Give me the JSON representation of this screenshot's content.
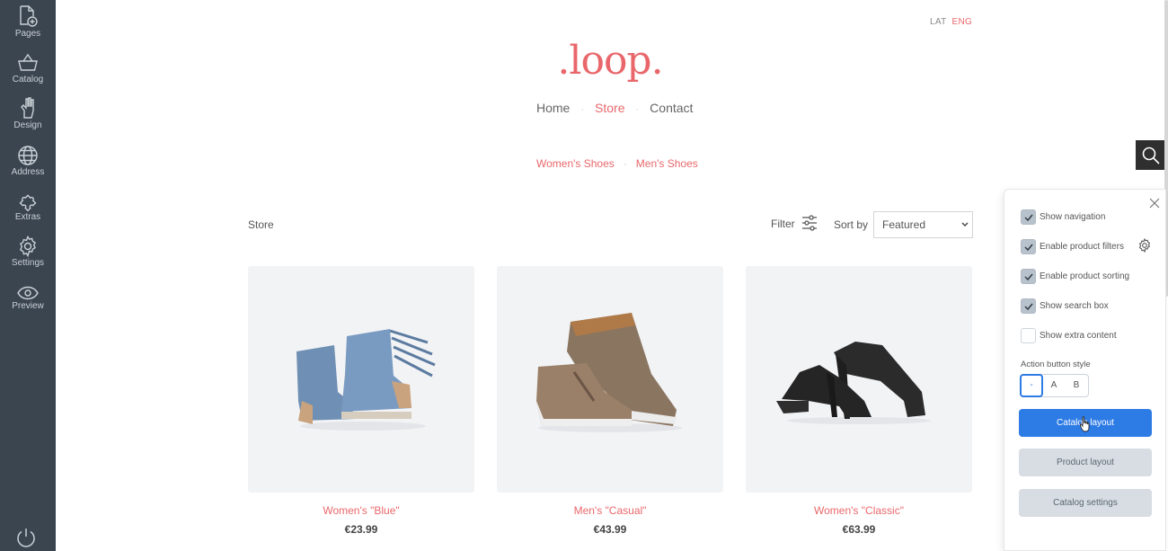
{
  "sidebar": {
    "items": [
      {
        "label": "Pages",
        "icon": "page-add-icon"
      },
      {
        "label": "Catalog",
        "icon": "basket-icon"
      },
      {
        "label": "Design",
        "icon": "hand-brush-icon"
      },
      {
        "label": "Address",
        "icon": "globe-icon"
      },
      {
        "label": "Extras",
        "icon": "puzzle-icon"
      },
      {
        "label": "Settings",
        "icon": "gear-icon"
      },
      {
        "label": "Preview",
        "icon": "eye-icon"
      }
    ],
    "power_icon": "power-icon"
  },
  "languages": {
    "lat": "LAT",
    "eng": "ENG",
    "active": "ENG"
  },
  "site": {
    "logo": ".loop.",
    "nav": {
      "home": "Home",
      "store": "Store",
      "contact": "Contact",
      "active": "Store"
    },
    "categories": {
      "women": "Women's Shoes",
      "men": "Men's Shoes"
    }
  },
  "toolbar": {
    "breadcrumb": "Store",
    "filter_label": "Filter",
    "sort_label": "Sort by",
    "sort_value": "Featured"
  },
  "products": [
    {
      "name": "Women's \"Blue\"",
      "price": "€23.99"
    },
    {
      "name": "Men's \"Casual\"",
      "price": "€43.99"
    },
    {
      "name": "Women's \"Classic\"",
      "price": "€63.99"
    }
  ],
  "panel": {
    "options": [
      {
        "label": "Show navigation",
        "checked": true
      },
      {
        "label": "Enable product filters",
        "checked": true
      },
      {
        "label": "Enable product sorting",
        "checked": true
      },
      {
        "label": "Show search box",
        "checked": true
      },
      {
        "label": "Show extra content",
        "checked": false
      }
    ],
    "action_button_style_label": "Action button style",
    "styles": [
      "-",
      "A",
      "B"
    ],
    "selected_style": "-",
    "buttons": {
      "catalog_layout": "Catalog layout",
      "product_layout": "Product layout",
      "catalog_settings": "Catalog settings"
    }
  },
  "colors": {
    "accent": "#e9676b",
    "primary": "#2d7be5",
    "sidebar": "#3b4550"
  }
}
